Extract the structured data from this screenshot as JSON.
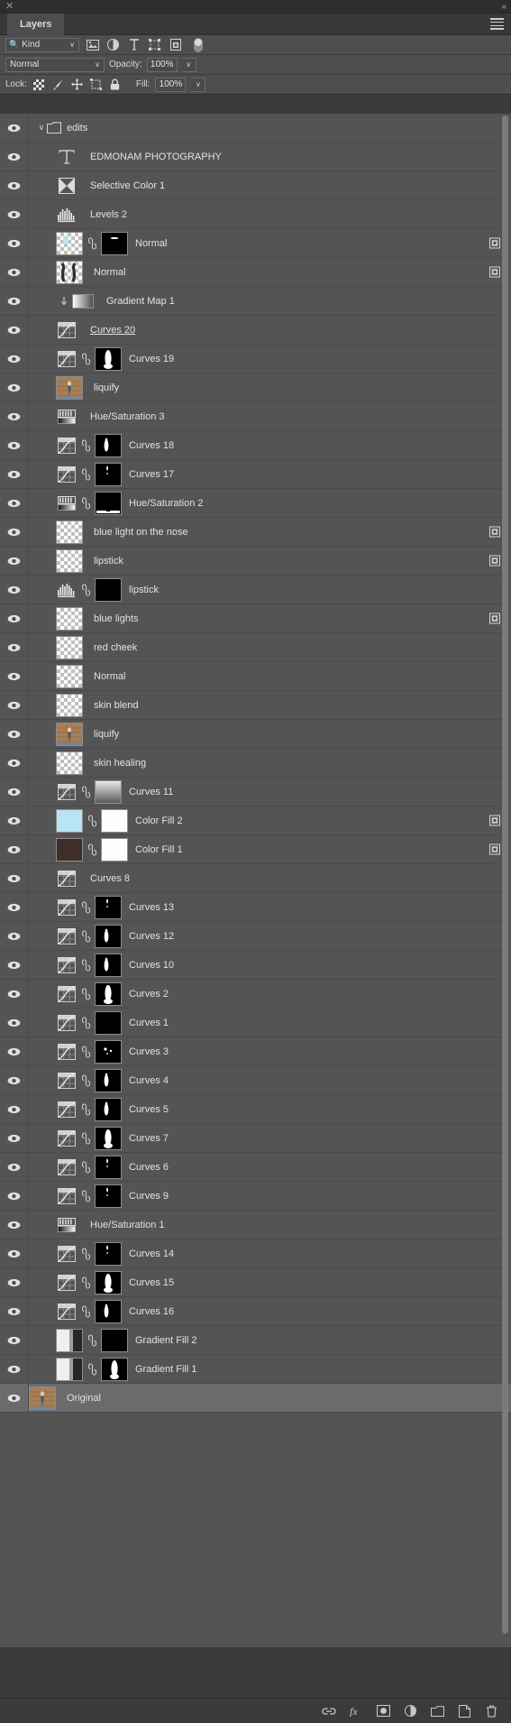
{
  "window": {
    "close_label": "✕",
    "collapse_label": "«",
    "tab_label": "Layers",
    "menu_icon": "hamburger-menu-icon"
  },
  "filter_bar": {
    "kind_label": "Kind",
    "search_icon": "search-icon",
    "chevron": "∨",
    "filters": [
      {
        "name": "filter-pixel-layers",
        "icon": "image-icon"
      },
      {
        "name": "filter-adjustment-layers",
        "icon": "half-circle-icon"
      },
      {
        "name": "filter-type-layers",
        "icon": "text-t-icon"
      },
      {
        "name": "filter-shape-layers",
        "icon": "shape-icon"
      },
      {
        "name": "filter-smart-objects",
        "icon": "smart-object-icon"
      }
    ],
    "toggle_name": "filter-enable-toggle"
  },
  "blend_bar": {
    "blend_mode": "Normal",
    "opacity_label": "Opacity:",
    "opacity_value": "100%",
    "chevron": "∨"
  },
  "lock_bar": {
    "lock_label": "Lock:",
    "locks": [
      {
        "name": "lock-transparent-pixels",
        "icon": "checkerboard-icon"
      },
      {
        "name": "lock-image-pixels",
        "icon": "brush-icon"
      },
      {
        "name": "lock-position",
        "icon": "move-arrows-icon"
      },
      {
        "name": "lock-artboard-nesting",
        "icon": "artboard-icon"
      },
      {
        "name": "lock-all",
        "icon": "padlock-icon"
      }
    ],
    "fill_label": "Fill:",
    "fill_value": "100%",
    "chevron": "∨"
  },
  "bottom_bar": {
    "buttons": [
      {
        "name": "link-layers-button",
        "icon": "chain-link-icon"
      },
      {
        "name": "layer-style-button",
        "icon": "fx-icon",
        "label": "fx"
      },
      {
        "name": "add-layer-mask-button",
        "icon": "mask-icon"
      },
      {
        "name": "new-adjustment-layer-button",
        "icon": "half-circle-icon"
      },
      {
        "name": "new-group-button",
        "icon": "folder-icon"
      },
      {
        "name": "new-layer-button",
        "icon": "plus-page-icon"
      },
      {
        "name": "delete-layer-button",
        "icon": "trash-icon"
      }
    ]
  },
  "layers": [
    {
      "name": "edits",
      "type": "group",
      "indent": 0,
      "visible": true,
      "expanded": true,
      "selected": false
    },
    {
      "name": "EDMONAM  PHOTOGRAPHY",
      "type": "text",
      "indent": 1,
      "visible": true,
      "selected": false
    },
    {
      "name": "Selective Color 1",
      "type": "adjustment",
      "adj_icon": "selective-color-icon",
      "indent": 1,
      "visible": true,
      "selected": false
    },
    {
      "name": "Levels 2",
      "type": "adjustment",
      "adj_icon": "levels-icon",
      "indent": 1,
      "visible": true,
      "selected": false
    },
    {
      "name": "Normal",
      "type": "pixel-mask",
      "indent": 1,
      "visible": true,
      "linked": true,
      "mask": "small-white-mark",
      "thumb": "transparent-blue",
      "badge": "smart-object-badge",
      "selected": false
    },
    {
      "name": "Normal",
      "type": "pixel",
      "indent": 1,
      "visible": true,
      "thumb": "transparent-dark-strokes",
      "badge": "smart-object-badge",
      "selected": false
    },
    {
      "name": "Gradient Map 1",
      "type": "adjustment-clipped",
      "adj_icon": "gradient-icon",
      "indent": 1,
      "visible": true,
      "clipped": true,
      "selected": false
    },
    {
      "name": "Curves 20",
      "type": "adjustment",
      "adj_icon": "curves-icon",
      "indent": 1,
      "visible": true,
      "underlined": true,
      "selected": false
    },
    {
      "name": "Curves 19",
      "type": "adjustment-mask",
      "adj_icon": "curves-icon",
      "indent": 1,
      "visible": true,
      "linked": true,
      "mask": "tall-white-blob",
      "selected": false
    },
    {
      "name": "liquify",
      "type": "pixel",
      "indent": 1,
      "visible": true,
      "thumb": "photo",
      "selected": false
    },
    {
      "name": "Hue/Saturation 3",
      "type": "adjustment",
      "adj_icon": "hue-sat-icon",
      "indent": 1,
      "visible": true,
      "selected": false
    },
    {
      "name": "Curves 18",
      "type": "adjustment-mask",
      "adj_icon": "curves-icon",
      "indent": 1,
      "visible": true,
      "linked": true,
      "mask": "small-white-blob",
      "selected": false
    },
    {
      "name": "Curves 17",
      "type": "adjustment-mask",
      "adj_icon": "curves-icon",
      "indent": 1,
      "visible": true,
      "linked": true,
      "mask": "tiny-white-dot",
      "selected": false
    },
    {
      "name": "Hue/Saturation 2",
      "type": "adjustment-mask",
      "adj_icon": "hue-sat-icon",
      "indent": 1,
      "visible": true,
      "linked": true,
      "mask": "bottom-white-bar",
      "selected": false
    },
    {
      "name": "blue light on the nose",
      "type": "pixel",
      "indent": 1,
      "visible": true,
      "thumb": "transparent",
      "badge": "smart-object-badge",
      "selected": false
    },
    {
      "name": "lipstick",
      "type": "pixel",
      "indent": 1,
      "visible": true,
      "thumb": "transparent",
      "badge": "smart-object-badge",
      "selected": false
    },
    {
      "name": "lipstick",
      "type": "adjustment-mask",
      "adj_icon": "levels-icon",
      "indent": 1,
      "visible": true,
      "linked": true,
      "mask": "black",
      "selected": false
    },
    {
      "name": "blue lights",
      "type": "pixel",
      "indent": 1,
      "visible": true,
      "thumb": "transparent",
      "badge": "smart-object-badge",
      "selected": false
    },
    {
      "name": "red cheek",
      "type": "pixel",
      "indent": 1,
      "visible": true,
      "thumb": "transparent",
      "selected": false
    },
    {
      "name": "Normal",
      "type": "pixel",
      "indent": 1,
      "visible": true,
      "thumb": "transparent",
      "selected": false
    },
    {
      "name": "skin blend",
      "type": "pixel",
      "indent": 1,
      "visible": true,
      "thumb": "transparent",
      "selected": false
    },
    {
      "name": "liquify",
      "type": "pixel",
      "indent": 1,
      "visible": true,
      "thumb": "photo",
      "selected": false
    },
    {
      "name": "skin healing",
      "type": "pixel",
      "indent": 1,
      "visible": true,
      "thumb": "transparent",
      "selected": false
    },
    {
      "name": "Curves 11",
      "type": "adjustment-mask",
      "adj_icon": "curves-icon",
      "indent": 1,
      "visible": true,
      "linked": true,
      "mask": "gradient-gray",
      "selected": false
    },
    {
      "name": "Color Fill 2",
      "type": "fill-mask",
      "indent": 1,
      "visible": true,
      "linked": true,
      "thumb": "light-blue",
      "mask": "white",
      "badge": "smart-object-badge",
      "selected": false
    },
    {
      "name": "Color Fill 1",
      "type": "fill-mask",
      "indent": 1,
      "visible": true,
      "linked": true,
      "thumb": "dark-brown",
      "mask": "white",
      "badge": "smart-object-badge",
      "selected": false
    },
    {
      "name": "Curves 8",
      "type": "adjustment",
      "adj_icon": "curves-icon",
      "indent": 1,
      "visible": true,
      "selected": false
    },
    {
      "name": "Curves 13",
      "type": "adjustment-mask",
      "adj_icon": "curves-icon",
      "indent": 1,
      "visible": true,
      "linked": true,
      "mask": "tiny-white-dot",
      "selected": false
    },
    {
      "name": "Curves 12",
      "type": "adjustment-mask",
      "adj_icon": "curves-icon",
      "indent": 1,
      "visible": true,
      "linked": true,
      "mask": "small-white-blob",
      "selected": false
    },
    {
      "name": "Curves 10",
      "type": "adjustment-mask",
      "adj_icon": "curves-icon",
      "indent": 1,
      "visible": true,
      "linked": true,
      "mask": "small-white-blob",
      "selected": false
    },
    {
      "name": "Curves 2",
      "type": "adjustment-mask",
      "adj_icon": "curves-icon",
      "indent": 1,
      "visible": true,
      "linked": true,
      "mask": "tall-white-blob",
      "selected": false
    },
    {
      "name": "Curves 1",
      "type": "adjustment-mask",
      "adj_icon": "curves-icon",
      "indent": 1,
      "visible": true,
      "linked": true,
      "mask": "black",
      "selected": false
    },
    {
      "name": "Curves 3",
      "type": "adjustment-mask",
      "adj_icon": "curves-icon",
      "indent": 1,
      "visible": true,
      "linked": true,
      "mask": "small-white-dots",
      "selected": false
    },
    {
      "name": "Curves 4",
      "type": "adjustment-mask",
      "adj_icon": "curves-icon",
      "indent": 1,
      "visible": true,
      "linked": true,
      "mask": "small-white-blob",
      "selected": false
    },
    {
      "name": "Curves 5",
      "type": "adjustment-mask",
      "adj_icon": "curves-icon",
      "indent": 1,
      "visible": true,
      "linked": true,
      "mask": "small-white-blob",
      "selected": false
    },
    {
      "name": "Curves 7",
      "type": "adjustment-mask",
      "adj_icon": "curves-icon",
      "indent": 1,
      "visible": true,
      "linked": true,
      "mask": "tall-white-blob",
      "selected": false
    },
    {
      "name": "Curves 6",
      "type": "adjustment-mask",
      "adj_icon": "curves-icon",
      "indent": 1,
      "visible": true,
      "linked": true,
      "mask": "tiny-white-dot",
      "selected": false
    },
    {
      "name": "Curves 9",
      "type": "adjustment-mask",
      "adj_icon": "curves-icon",
      "indent": 1,
      "visible": true,
      "linked": true,
      "mask": "tiny-white-dot",
      "selected": false
    },
    {
      "name": "Hue/Saturation 1",
      "type": "adjustment",
      "adj_icon": "hue-sat-icon",
      "indent": 1,
      "visible": true,
      "selected": false
    },
    {
      "name": "Curves 14",
      "type": "adjustment-mask",
      "adj_icon": "curves-icon",
      "indent": 1,
      "visible": true,
      "linked": true,
      "mask": "tiny-white-dot",
      "selected": false
    },
    {
      "name": "Curves 15",
      "type": "adjustment-mask",
      "adj_icon": "curves-icon",
      "indent": 1,
      "visible": true,
      "linked": true,
      "mask": "tall-white-blob",
      "selected": false
    },
    {
      "name": "Curves 16",
      "type": "adjustment-mask",
      "adj_icon": "curves-icon",
      "indent": 1,
      "visible": true,
      "linked": true,
      "mask": "small-white-blob",
      "selected": false
    },
    {
      "name": "Gradient Fill 2",
      "type": "fill-mask",
      "indent": 1,
      "visible": true,
      "linked": true,
      "thumb": "gradient-bw",
      "mask": "black",
      "selected": false
    },
    {
      "name": "Gradient Fill 1",
      "type": "fill-mask",
      "indent": 1,
      "visible": true,
      "linked": true,
      "thumb": "gradient-bw",
      "mask": "tall-white-blob",
      "selected": false
    },
    {
      "name": "Original",
      "type": "pixel",
      "indent": 0,
      "visible": true,
      "thumb": "photo",
      "selected": true
    }
  ]
}
